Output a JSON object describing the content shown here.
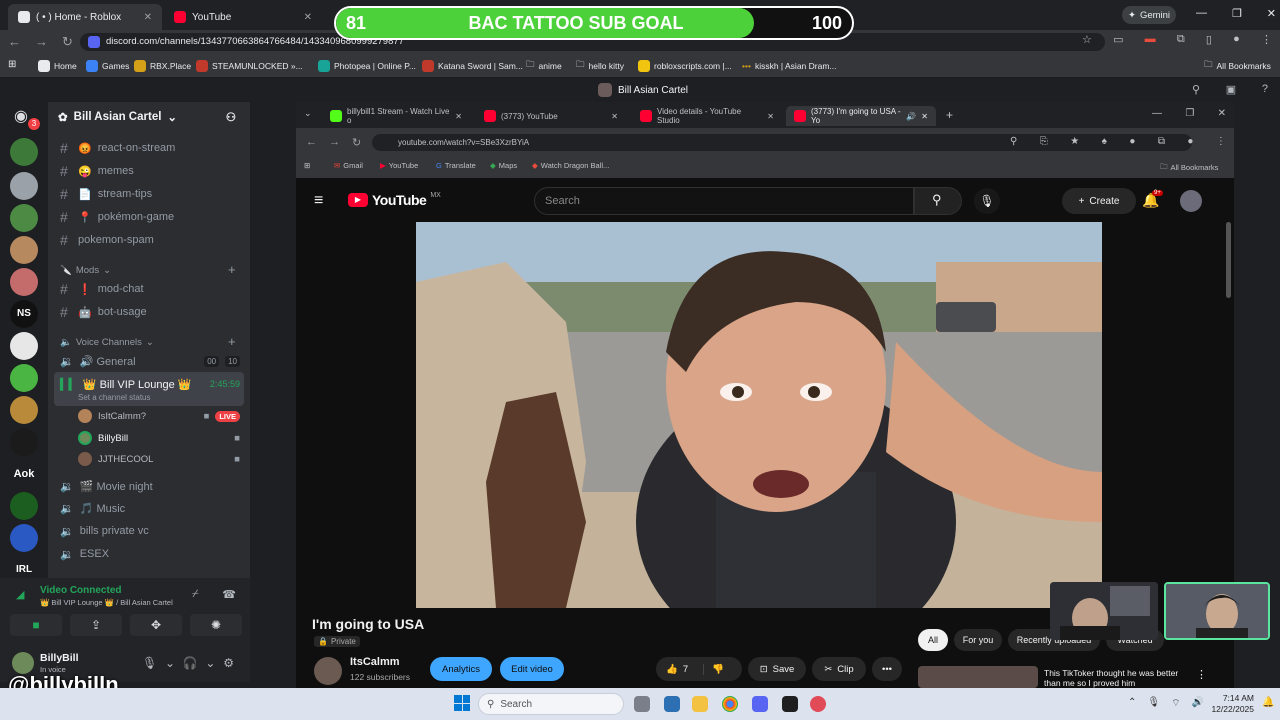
{
  "outer_tabs": [
    {
      "label": "( • ) Home - Roblox"
    },
    {
      "label": "YouTube"
    }
  ],
  "outer_tab_new": "+",
  "profile_button": "Gemini",
  "outer_url": "discord.com/channels/1343770663864766484/1433409680999279877",
  "outer_bookmarks": [
    "Home",
    "Games",
    "RBX.Place",
    "STEAMUNLOCKED »...",
    "Photopea | Online P...",
    "Katana Sword | Sam...",
    "anime",
    "hello kitty",
    "robloxscripts.com |...",
    "kisskh | Asian Dram..."
  ],
  "outer_all_bookmarks": "All Bookmarks",
  "goal": {
    "current": "81",
    "label": "BAC TATTOO SUB GOAL",
    "target": "100",
    "progress": 0.81,
    "fill_color": "#4cd13a"
  },
  "discord": {
    "window_title": "Bill Asian Cartel",
    "server_name": "Bill Asian Cartel",
    "server_icon_badge": "3",
    "server_icon_labels": [
      "NS",
      "Aok",
      "IRL"
    ],
    "text_channels": [
      {
        "icon": "😡",
        "name": "react-on-stream"
      },
      {
        "icon": "😜",
        "name": "memes"
      },
      {
        "icon": "📄",
        "name": "stream-tips"
      },
      {
        "icon": "📍",
        "name": "pokémon-game"
      },
      {
        "icon": "",
        "name": "pokemon-spam"
      }
    ],
    "mods_category": "Mods",
    "mod_channels": [
      {
        "icon": "❗",
        "name": "mod-chat"
      },
      {
        "icon": "🤖",
        "name": "bot-usage"
      }
    ],
    "voice_category": "Voice Channels",
    "voice_channels": [
      {
        "name": "🔊 General",
        "badge_a": "00",
        "badge_b": "10"
      },
      {
        "name": "👑 Bill VIP Lounge 👑",
        "timer": "2:45:59",
        "status": "Set a channel status"
      }
    ],
    "voice_users": [
      {
        "name": "IsItCalmm?",
        "badge": "LIVE"
      },
      {
        "name": "BillyBill"
      },
      {
        "name": "JJTHECOOL"
      }
    ],
    "more_voice_channels": [
      "🎬 Movie night",
      "🎵 Music",
      "bills private vc",
      "ESEX"
    ],
    "connection": {
      "status": "Video Connected",
      "location": "👑 Bill VIP Lounge 👑 / Bill Asian Cartel"
    },
    "user": {
      "name": "BillyBill",
      "substatus": "In voice"
    }
  },
  "inner_browser": {
    "tabs": [
      {
        "label": "billybill1 Stream - Watch Live o",
        "color": "#53fc18"
      },
      {
        "label": "(3773) YouTube",
        "color": "#ff0033"
      },
      {
        "label": "Video details - YouTube Studio",
        "color": "#ff0033"
      },
      {
        "label": "(3773) I'm going to USA - Yo",
        "color": "#ff0033"
      }
    ],
    "url": "youtube.com/watch?v=SBe3XzrBYiA",
    "bookmarks": [
      "Gmail",
      "YouTube",
      "Translate",
      "Maps",
      "Watch Dragon Ball..."
    ],
    "all_bookmarks": "All Bookmarks"
  },
  "youtube": {
    "logo_text": "YouTube",
    "region": "MX",
    "search_placeholder": "Search",
    "create_label": "Create",
    "notification_badge": "9+",
    "video_title": "I'm going to USA",
    "privacy": "Private",
    "channel_name": "ItsCalmm",
    "subscribers": "122 subscribers",
    "analytics_label": "Analytics",
    "edit_label": "Edit video",
    "likes": "7",
    "save_label": "Save",
    "clip_label": "Clip",
    "filter_chips": [
      "All",
      "For you",
      "Recently uploaded",
      "Watched"
    ],
    "suggestion_text": "This TikToker thought he was better than me so I proved him"
  },
  "watermark": "@billybilln",
  "taskbar": {
    "search_placeholder": "Search",
    "time": "7:14 AM",
    "date": "12/22/2025"
  }
}
